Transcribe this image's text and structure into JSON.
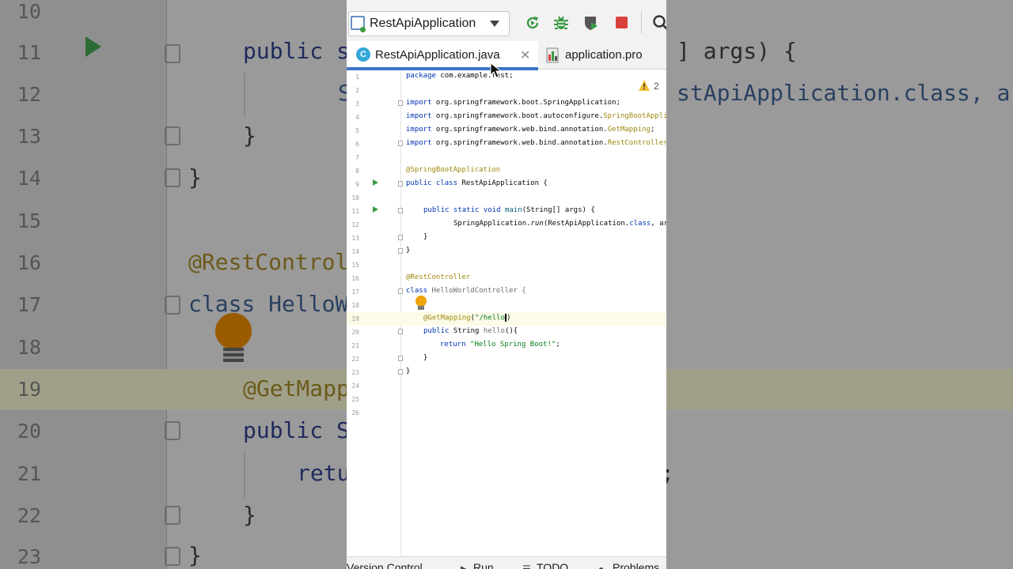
{
  "background": {
    "lines": [
      {
        "num": "10",
        "text": ""
      },
      {
        "num": "11",
        "text": "public s"
      },
      {
        "num": "12",
        "text": "S"
      },
      {
        "num": "13",
        "text": "}"
      },
      {
        "num": "14",
        "text": "}"
      },
      {
        "num": "15",
        "text": ""
      },
      {
        "num": "16",
        "text": "@RestControl"
      },
      {
        "num": "17",
        "text": "class HelloW"
      },
      {
        "num": "18",
        "text": ""
      },
      {
        "num": "19",
        "text": "@GetMapp"
      },
      {
        "num": "20",
        "text": "public S"
      },
      {
        "num": "21",
        "text": "retu"
      },
      {
        "num": "22",
        "text": "}"
      },
      {
        "num": "23",
        "text": "}"
      }
    ],
    "right_texts": {
      "line11": "] args) {",
      "line12": "stApiApplication.class, ar",
      "line21": ";"
    }
  },
  "toolbar": {
    "run_config": "RestApiApplication",
    "rerun_icon": "rerun-icon",
    "debug_icon": "debug-icon",
    "coverage_icon": "coverage-icon",
    "stop_icon": "stop-icon",
    "search_icon": "search-icon"
  },
  "tabs": [
    {
      "label": "RestApiApplication.java",
      "active": true
    },
    {
      "label": "application.pro",
      "active": false
    }
  ],
  "warnings": {
    "count": "2"
  },
  "editor": {
    "lines": [
      {
        "num": "1"
      },
      {
        "num": "2"
      },
      {
        "num": "3"
      },
      {
        "num": "4"
      },
      {
        "num": "5"
      },
      {
        "num": "6"
      },
      {
        "num": "7"
      },
      {
        "num": "8"
      },
      {
        "num": "9"
      },
      {
        "num": "10"
      },
      {
        "num": "11"
      },
      {
        "num": "12"
      },
      {
        "num": "13"
      },
      {
        "num": "14"
      },
      {
        "num": "15"
      },
      {
        "num": "16"
      },
      {
        "num": "17"
      },
      {
        "num": "18"
      },
      {
        "num": "19"
      },
      {
        "num": "20"
      },
      {
        "num": "21"
      },
      {
        "num": "22"
      },
      {
        "num": "23"
      },
      {
        "num": "24"
      },
      {
        "num": "25"
      },
      {
        "num": "26"
      }
    ],
    "code": {
      "l1_kw": "package",
      "l1_rest": " com.example.rest;",
      "l3_kw": "import",
      "l3_rest": " org.springframework.boot.SpringApplication;",
      "l4_kw": "import",
      "l4_rest": " org.springframework.boot.autoconfigure.",
      "l4_ann": "SpringBootAppli",
      "l5_kw": "import",
      "l5_rest": " org.springframework.web.bind.annotation.",
      "l5_ann": "GetMapping",
      "l5_end": ";",
      "l6_kw": "import",
      "l6_rest": " org.springframework.web.bind.annotation.",
      "l6_ann": "RestController",
      "l8_ann": "@SpringBootApplication",
      "l9_kw": "public class",
      "l9_rest": " RestApiApplication {",
      "l11_kw": "public static void",
      "l11_m": " main",
      "l11_rest": "(String[] args) {",
      "l12_a": "SpringApplication.",
      "l12_m": "run",
      "l12_b": "(RestApiApplication.",
      "l12_kw": "class",
      "l12_c": ", ar",
      "l13": "}",
      "l14": "}",
      "l16_ann": "@RestController",
      "l17_kw": "class",
      "l17_rest": " HelloWorldController {",
      "l19_ann": "@GetMapping",
      "l19_a": "(",
      "l19_s": "\"/hello",
      "l19_b": ")",
      "l20_kw": "public",
      "l20_a": " String ",
      "l20_m": "hello",
      "l20_b": "(){",
      "l21_kw": "return",
      "l21_s": " \"Hello Spring Boot!\"",
      "l21_end": ";",
      "l22": "}",
      "l23": "}"
    }
  },
  "statusbar": {
    "version_control": "Version Control",
    "run": "Run",
    "todo": "TODO",
    "problems": "Problems"
  }
}
